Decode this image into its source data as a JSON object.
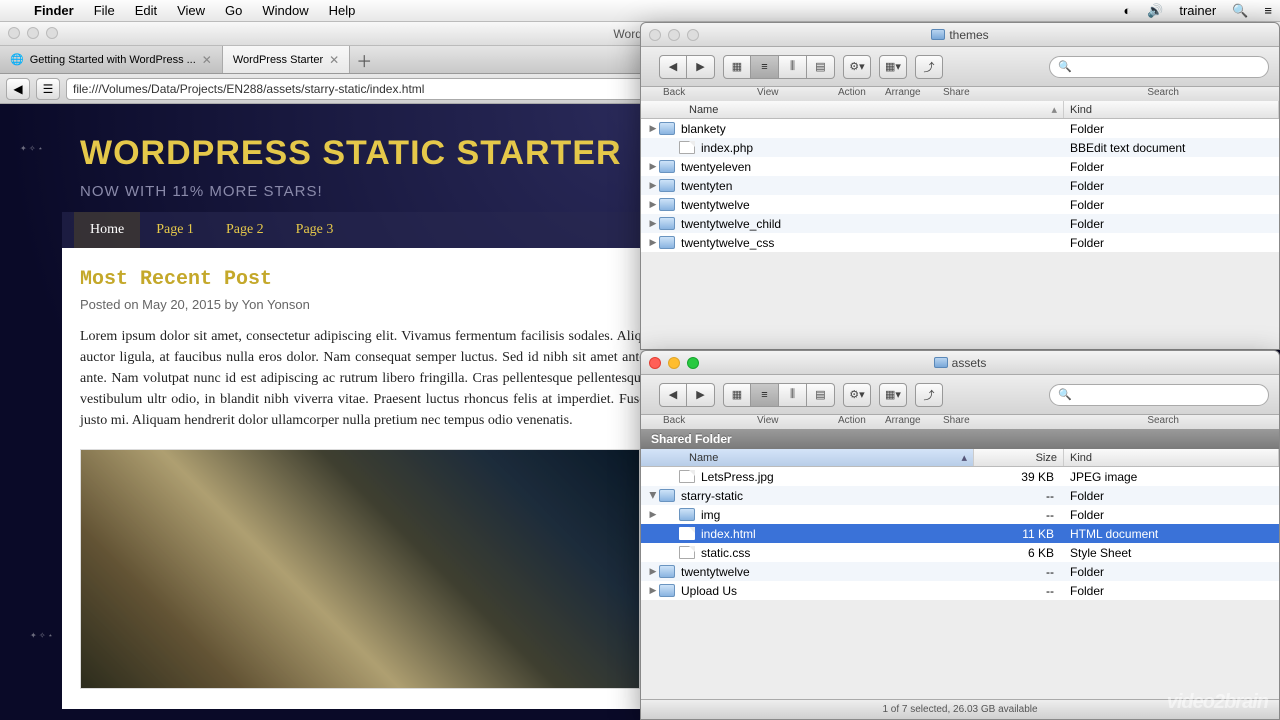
{
  "menubar": {
    "app": "Finder",
    "items": [
      "File",
      "Edit",
      "View",
      "Go",
      "Window",
      "Help"
    ],
    "user": "trainer"
  },
  "safari": {
    "windowTitle": "WordPres",
    "tabs": [
      {
        "label": "Getting Started with WordPress ...",
        "active": false
      },
      {
        "label": "WordPress Starter",
        "active": true
      }
    ],
    "url": "file:///Volumes/Data/Projects/EN288/assets/starry-static/index.html"
  },
  "page": {
    "title": "WORDPRESS STATIC STARTER",
    "subtitle": "NOW WITH 11% MORE STARS!",
    "nav": [
      "Home",
      "Page 1",
      "Page 2",
      "Page 3"
    ],
    "navCurrent": 0,
    "postTitle": "Most Recent Post",
    "postMeta": "Posted on May 20, 2015 by Yon Yonson",
    "postBody": "Lorem ipsum dolor sit amet, consectetur adipiscing elit. Vivamus fermentum facilisis sodales. Aliquam malesuada, urna at blandit tempus, magna quam auctor ligula, at faucibus nulla eros dolor. Nam consequat semper luctus. Sed id nibh sit amet ante ultrices cursus. Integer quis nis mauris, non sagittis ante. Nam volutpat nunc id est adipiscing ac rutrum libero fringilla. Cras pellentesque pellentesque ullamcorper. Nullam venenatis cursus placerat. Sed vestibulum ultr odio, in blandit nibh viverra vitae. Praesent luctus rhoncus felis at imperdiet. Fusce quis justo mattis odio congue dictum. Aenean nec justo mi. Aliquam hendrerit dolor ullamcorper nulla pretium nec tempus odio venenatis."
  },
  "finder1": {
    "title": "themes",
    "toolbar": {
      "back": "Back",
      "view": "View",
      "action": "Action",
      "arrange": "Arrange",
      "share": "Share",
      "search": "Search"
    },
    "cols": {
      "name": "Name",
      "kind": "Kind"
    },
    "rows": [
      {
        "name": "blankety",
        "kind": "Folder",
        "icon": "folder",
        "expand": true
      },
      {
        "name": "index.php",
        "kind": "BBEdit text document",
        "icon": "file",
        "expand": false,
        "indent": 1
      },
      {
        "name": "twentyeleven",
        "kind": "Folder",
        "icon": "folder",
        "expand": true
      },
      {
        "name": "twentyten",
        "kind": "Folder",
        "icon": "folder",
        "expand": true
      },
      {
        "name": "twentytwelve",
        "kind": "Folder",
        "icon": "folder",
        "expand": true
      },
      {
        "name": "twentytwelve_child",
        "kind": "Folder",
        "icon": "folder",
        "expand": true
      },
      {
        "name": "twentytwelve_css",
        "kind": "Folder",
        "icon": "folder",
        "expand": true
      }
    ]
  },
  "finder2": {
    "title": "assets",
    "section": "Shared Folder",
    "toolbar": {
      "back": "Back",
      "view": "View",
      "action": "Action",
      "arrange": "Arrange",
      "share": "Share",
      "search": "Search"
    },
    "cols": {
      "name": "Name",
      "size": "Size",
      "kind": "Kind"
    },
    "rows": [
      {
        "name": "LetsPress.jpg",
        "size": "39 KB",
        "kind": "JPEG image",
        "icon": "file",
        "indent": 1
      },
      {
        "name": "starry-static",
        "size": "--",
        "kind": "Folder",
        "icon": "folder",
        "expand": true,
        "open": true
      },
      {
        "name": "img",
        "size": "--",
        "kind": "Folder",
        "icon": "folder",
        "expand": true,
        "indent": 1
      },
      {
        "name": "index.html",
        "size": "11 KB",
        "kind": "HTML document",
        "icon": "file",
        "indent": 1,
        "selected": true
      },
      {
        "name": "static.css",
        "size": "6 KB",
        "kind": "Style Sheet",
        "icon": "file",
        "indent": 1
      },
      {
        "name": "twentytwelve",
        "size": "--",
        "kind": "Folder",
        "icon": "folder",
        "expand": true
      },
      {
        "name": "Upload Us",
        "size": "--",
        "kind": "Folder",
        "icon": "folder",
        "expand": true
      }
    ],
    "status": "1 of 7 selected, 26.03 GB available"
  },
  "watermark": "video2brain"
}
